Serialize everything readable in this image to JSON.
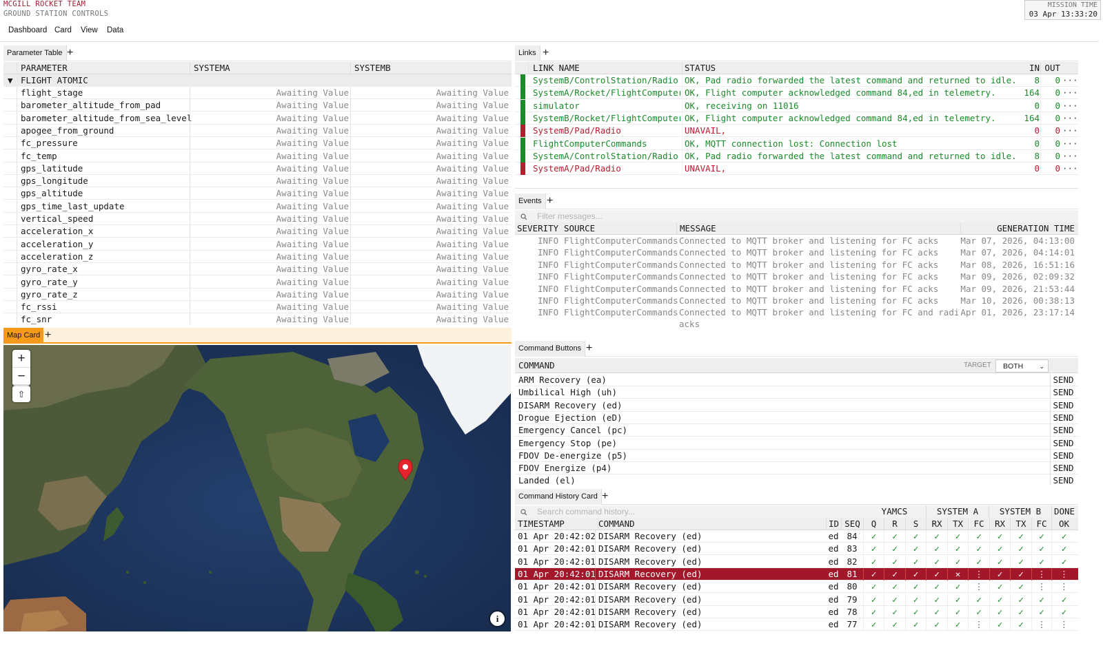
{
  "header": {
    "team": "MCGILL ROCKET TEAM",
    "subtitle": "GROUND STATION CONTROLS",
    "mission_time_label": "MISSION TIME",
    "mission_time_value": "03 Apr 13:33:20"
  },
  "menu": [
    "Dashboard",
    "Card",
    "View",
    "Data"
  ],
  "parameter_table": {
    "tab": "Parameter Table",
    "columns": [
      "PARAMETER",
      "SYSTEMA",
      "SYSTEMB"
    ],
    "group": "FLIGHT ATOMIC",
    "awaiting": "Awaiting Value",
    "rows": [
      "flight_stage",
      "barometer_altitude_from_pad",
      "barometer_altitude_from_sea_level",
      "apogee_from_ground",
      "fc_pressure",
      "fc_temp",
      "gps_latitude",
      "gps_longitude",
      "gps_altitude",
      "gps_time_last_update",
      "vertical_speed",
      "acceleration_x",
      "acceleration_y",
      "acceleration_z",
      "gyro_rate_x",
      "gyro_rate_y",
      "gyro_rate_z",
      "fc_rssi",
      "fc_snr"
    ]
  },
  "links": {
    "tab": "Links",
    "columns": [
      "LINK NAME",
      "STATUS",
      "IN",
      "OUT"
    ],
    "rows": [
      {
        "name": "SystemB/ControlStation/Radio",
        "status": "OK, Pad radio forwarded the latest command and returned to idle.",
        "in": "8",
        "out": "0",
        "state": "ok"
      },
      {
        "name": "SystemA/Rocket/FlightComputer",
        "status": "OK, Flight computer acknowledged command 84,ed in telemetry.",
        "in": "164",
        "out": "0",
        "state": "ok"
      },
      {
        "name": "simulator",
        "status": "OK, receiving on 11016",
        "in": "0",
        "out": "0",
        "state": "ok"
      },
      {
        "name": "SystemB/Rocket/FlightComputer",
        "status": "OK, Flight computer acknowledged command 84,ed in telemetry.",
        "in": "164",
        "out": "0",
        "state": "ok"
      },
      {
        "name": "SystemB/Pad/Radio",
        "status": "UNAVAIL,",
        "in": "0",
        "out": "0",
        "state": "err"
      },
      {
        "name": "FlightComputerCommands",
        "status": "OK, MQTT connection lost: Connection lost",
        "in": "0",
        "out": "0",
        "state": "ok"
      },
      {
        "name": "SystemA/ControlStation/Radio",
        "status": "OK, Pad radio forwarded the latest command and returned to idle.",
        "in": "8",
        "out": "0",
        "state": "ok"
      },
      {
        "name": "SystemA/Pad/Radio",
        "status": "UNAVAIL,",
        "in": "0",
        "out": "0",
        "state": "err"
      }
    ],
    "more": "···"
  },
  "events": {
    "tab": "Events",
    "filter_placeholder": "Filter messages...",
    "columns": [
      "SEVERITY",
      "SOURCE",
      "MESSAGE",
      "GENERATION TIME"
    ],
    "rows": [
      {
        "sev": "INFO",
        "src": "FlightComputerCommands",
        "msg": "Connected to MQTT broker and listening for FC acks",
        "time": "Mar 07, 2026, 04:13:00"
      },
      {
        "sev": "INFO",
        "src": "FlightComputerCommands",
        "msg": "Connected to MQTT broker and listening for FC acks",
        "time": "Mar 07, 2026, 04:14:01"
      },
      {
        "sev": "INFO",
        "src": "FlightComputerCommands",
        "msg": "Connected to MQTT broker and listening for FC acks",
        "time": "Mar 08, 2026, 16:51:16"
      },
      {
        "sev": "INFO",
        "src": "FlightComputerCommands",
        "msg": "Connected to MQTT broker and listening for FC acks",
        "time": "Mar 09, 2026, 02:09:32"
      },
      {
        "sev": "INFO",
        "src": "FlightComputerCommands",
        "msg": "Connected to MQTT broker and listening for FC acks",
        "time": "Mar 09, 2026, 21:53:44"
      },
      {
        "sev": "INFO",
        "src": "FlightComputerCommands",
        "msg": "Connected to MQTT broker and listening for FC acks",
        "time": "Mar 10, 2026, 00:38:13"
      },
      {
        "sev": "INFO",
        "src": "FlightComputerCommands",
        "msg": "Connected to MQTT broker and listening for FC and radio",
        "msg2": "acks",
        "time": "Apr 01, 2026, 23:17:14"
      }
    ]
  },
  "command_buttons": {
    "tab": "Command Buttons",
    "column": "COMMAND",
    "target_label": "TARGET",
    "target_value": "BOTH",
    "send_label": "SEND",
    "commands": [
      "ARM Recovery (ea)",
      "Umbilical High (uh)",
      "DISARM Recovery (ed)",
      "Drogue Ejection (eD)",
      "Emergency Cancel (pc)",
      "Emergency Stop (pe)",
      "FDOV De-energize (p5)",
      "FDOV Energize (p4)",
      "Landed (el)"
    ]
  },
  "map": {
    "tab": "Map Card",
    "zoom_in": "+",
    "zoom_out": "−",
    "compass": "⇧",
    "info": "i"
  },
  "command_history": {
    "tab": "Command History Card",
    "search_placeholder": "Search command history...",
    "groups": [
      "YAMCS",
      "SYSTEM A",
      "SYSTEM B",
      "DONE"
    ],
    "columns": [
      "TIMESTAMP",
      "COMMAND",
      "ID",
      "SEQ",
      "Q",
      "R",
      "S",
      "RX",
      "TX",
      "FC",
      "RX",
      "TX",
      "FC",
      "OK"
    ],
    "rows": [
      {
        "ts": "01 Apr 20:42:02",
        "cmd": "DISARM Recovery (ed)",
        "id": "ed",
        "seq": "84",
        "marks": [
          "✓",
          "✓",
          "✓",
          "✓",
          "✓",
          "✓",
          "✓",
          "✓",
          "✓",
          "✓"
        ],
        "hl": false
      },
      {
        "ts": "01 Apr 20:42:01",
        "cmd": "DISARM Recovery (ed)",
        "id": "ed",
        "seq": "83",
        "marks": [
          "✓",
          "✓",
          "✓",
          "✓",
          "✓",
          "✓",
          "✓",
          "✓",
          "✓",
          "✓"
        ],
        "hl": false
      },
      {
        "ts": "01 Apr 20:42:01",
        "cmd": "DISARM Recovery (ed)",
        "id": "ed",
        "seq": "82",
        "marks": [
          "✓",
          "✓",
          "✓",
          "✓",
          "✓",
          "✓",
          "✓",
          "✓",
          "✓",
          "✓"
        ],
        "hl": false
      },
      {
        "ts": "01 Apr 20:42:01",
        "cmd": "DISARM Recovery (ed)",
        "id": "ed",
        "seq": "81",
        "marks": [
          "✓",
          "✓",
          "✓",
          "✓",
          "✕",
          "⋮",
          "✓",
          "✓",
          "⋮",
          "⋮"
        ],
        "hl": true
      },
      {
        "ts": "01 Apr 20:42:01",
        "cmd": "DISARM Recovery (ed)",
        "id": "ed",
        "seq": "80",
        "marks": [
          "✓",
          "✓",
          "✓",
          "✓",
          "✓",
          "⋮",
          "✓",
          "✓",
          "⋮",
          "⋮"
        ],
        "hl": false
      },
      {
        "ts": "01 Apr 20:42:01",
        "cmd": "DISARM Recovery (ed)",
        "id": "ed",
        "seq": "79",
        "marks": [
          "✓",
          "✓",
          "✓",
          "✓",
          "✓",
          "✓",
          "✓",
          "✓",
          "✓",
          "✓"
        ],
        "hl": false
      },
      {
        "ts": "01 Apr 20:42:01",
        "cmd": "DISARM Recovery (ed)",
        "id": "ed",
        "seq": "78",
        "marks": [
          "✓",
          "✓",
          "✓",
          "✓",
          "✓",
          "✓",
          "✓",
          "✓",
          "✓",
          "✓"
        ],
        "hl": false
      },
      {
        "ts": "01 Apr 20:42:01",
        "cmd": "DISARM Recovery (ed)",
        "id": "ed",
        "seq": "77",
        "marks": [
          "✓",
          "✓",
          "✓",
          "✓",
          "✓",
          "⋮",
          "✓",
          "✓",
          "⋮",
          "⋮"
        ],
        "hl": false
      }
    ]
  },
  "colors": {
    "brand": "#a31d2e",
    "ok": "#1a8a2a",
    "error": "#b51d2e",
    "highlight_row": "#a3172b",
    "map_tab_bg": "#fde9c8",
    "map_tab_accent": "#f59a1b"
  }
}
